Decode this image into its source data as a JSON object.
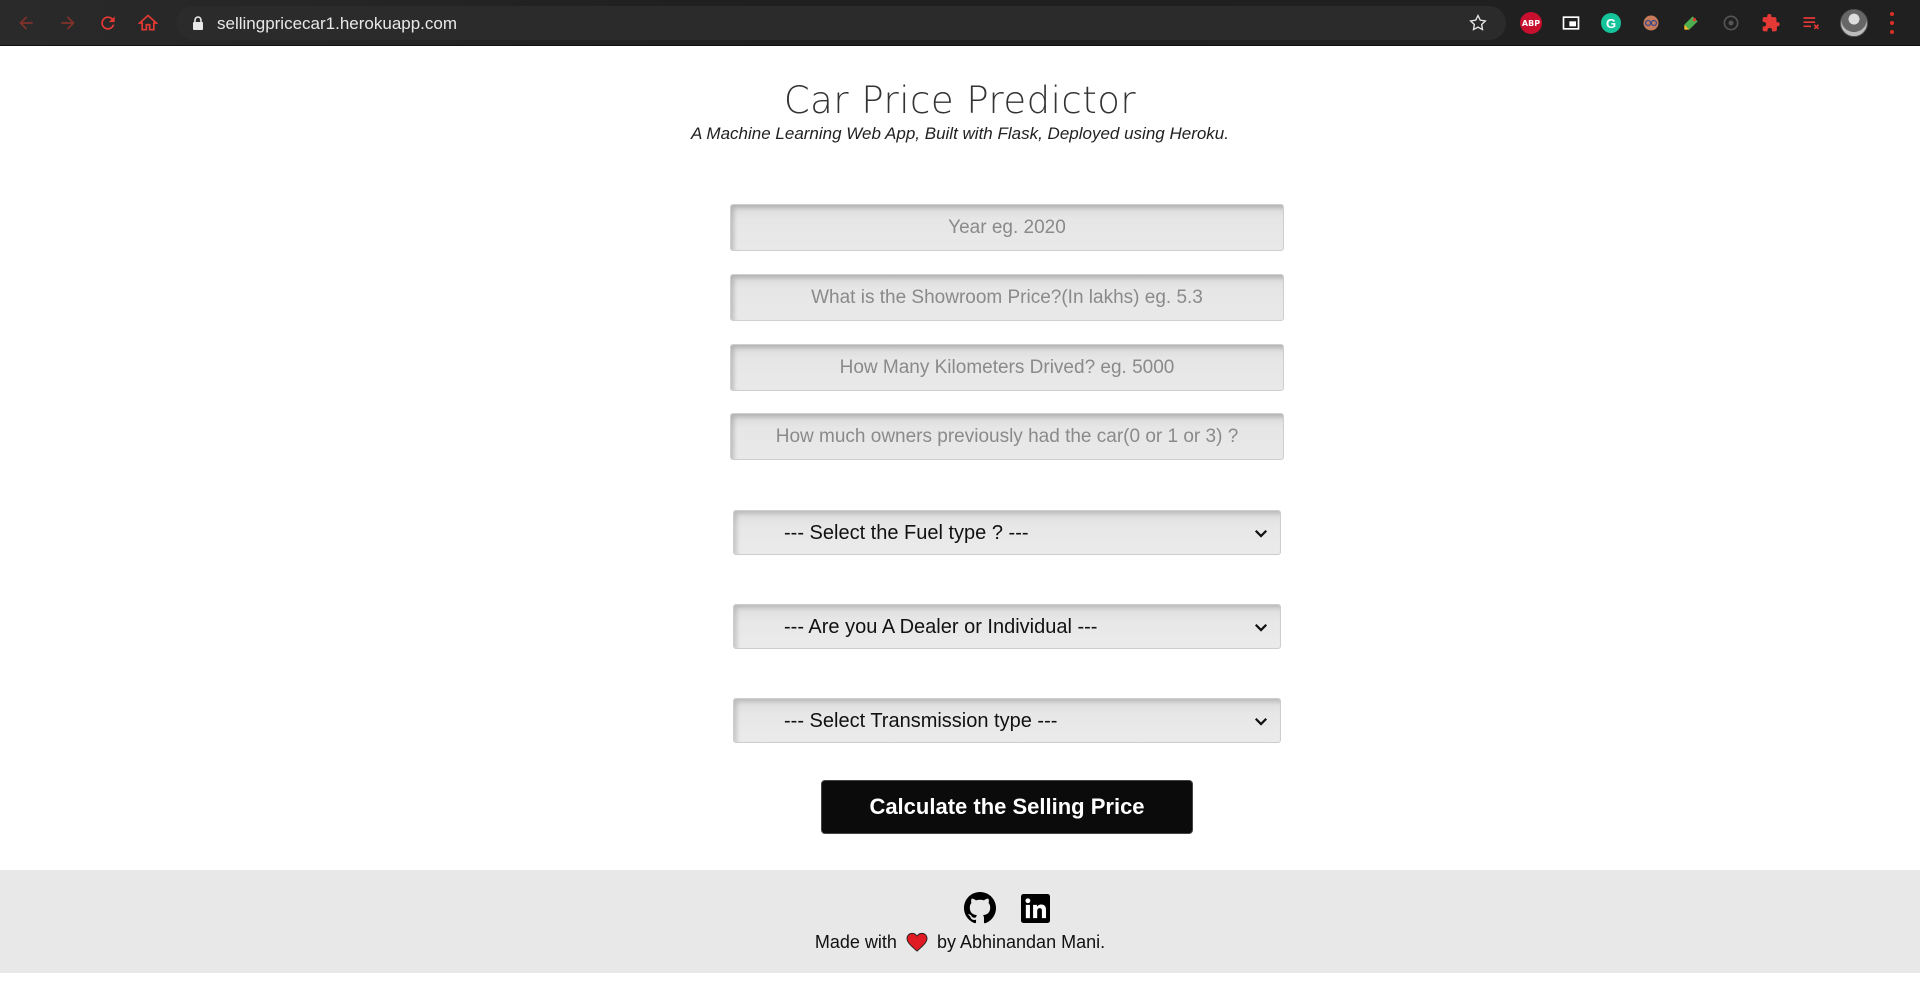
{
  "browser": {
    "url": "sellingpricecar1.herokuapp.com",
    "extensions": [
      "abp-icon",
      "screen-capture-icon",
      "grammarly-icon",
      "glasses-icon",
      "color-picker-icon",
      "disabled-extension-icon",
      "puzzle-icon",
      "list-icon"
    ]
  },
  "header": {
    "title": "Car Price Predictor",
    "subtitle": "A Machine Learning Web App, Built with Flask, Deployed using Heroku."
  },
  "form": {
    "year_placeholder": "Year eg. 2020",
    "price_placeholder": "What is the Showroom Price?(In lakhs) eg. 5.3",
    "km_placeholder": "How Many Kilometers Drived? eg. 5000",
    "owners_placeholder": "How much owners previously had the car(0 or 1 or 3) ?",
    "fuel_select": "--- Select the Fuel type ? ---",
    "seller_select": "--- Are you A Dealer or Individual ---",
    "transmission_select": "--- Select Transmission type ---",
    "submit_label": "Calculate the Selling Price"
  },
  "footer": {
    "made_prefix": "Made with",
    "made_suffix": "by Abhinandan Mani."
  },
  "colors": {
    "accent_red": "#d93025",
    "button_bg": "#0b0b0b",
    "footer_bg": "#e8e8e8"
  }
}
